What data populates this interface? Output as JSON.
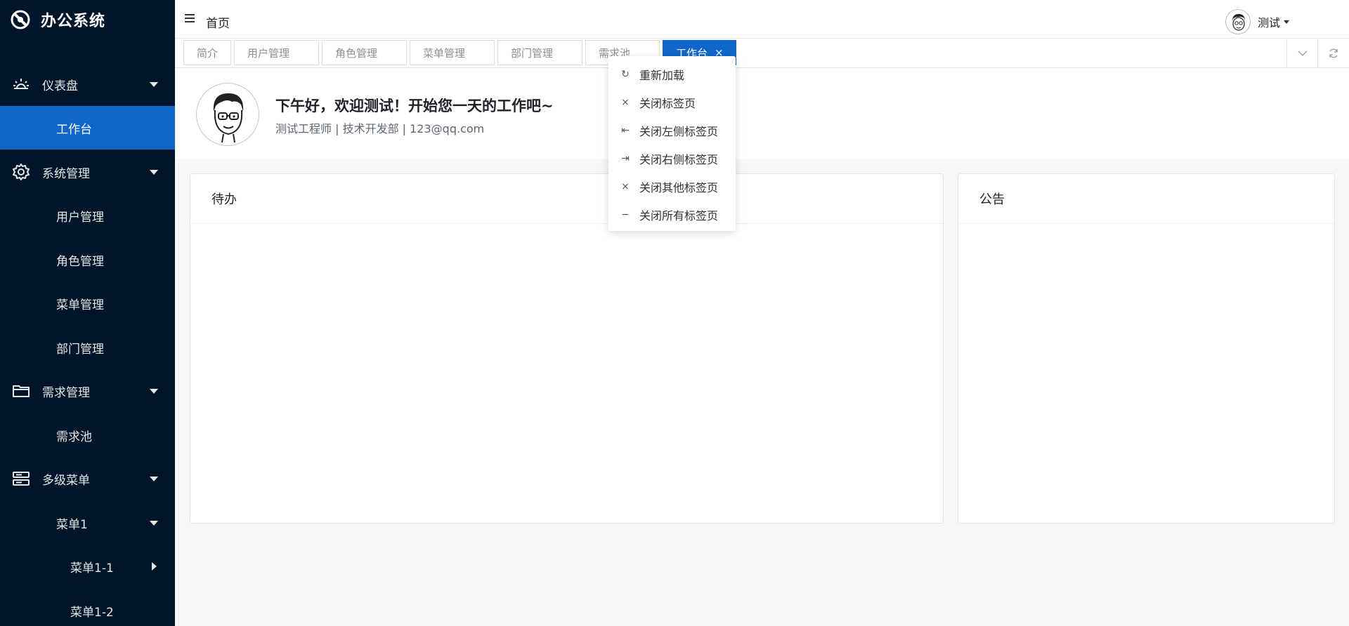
{
  "app": {
    "title": "办公系统"
  },
  "sidebar": {
    "items": [
      {
        "label": "仪表盘",
        "icon": "dashboard-icon",
        "level": 0,
        "caret": "down"
      },
      {
        "label": "工作台",
        "level": 1,
        "active": true
      },
      {
        "label": "系统管理",
        "icon": "gear-icon",
        "level": 0,
        "caret": "down"
      },
      {
        "label": "用户管理",
        "level": 1
      },
      {
        "label": "角色管理",
        "level": 1
      },
      {
        "label": "菜单管理",
        "level": 1
      },
      {
        "label": "部门管理",
        "level": 1
      },
      {
        "label": "需求管理",
        "icon": "folder-icon",
        "level": 0,
        "caret": "down"
      },
      {
        "label": "需求池",
        "level": 1
      },
      {
        "label": "多级菜单",
        "icon": "server-icon",
        "level": 0,
        "caret": "down"
      },
      {
        "label": "菜单1",
        "level": 1,
        "caret": "down"
      },
      {
        "label": "菜单1-1",
        "level": 2,
        "caret": "right"
      },
      {
        "label": "菜单1-2",
        "level": 2
      }
    ]
  },
  "header": {
    "breadcrumb": "首页",
    "user_name": "测试"
  },
  "tabs": [
    {
      "label": "简介"
    },
    {
      "label": "用户管理"
    },
    {
      "label": "角色管理"
    },
    {
      "label": "菜单管理"
    },
    {
      "label": "部门管理"
    },
    {
      "label": "需求池"
    },
    {
      "label": "工作台",
      "active": true,
      "close": "×"
    }
  ],
  "welcome": {
    "greeting": "下午好，欢迎测试！开始您一天的工作吧~",
    "subtitle": "测试工程师 | 技术开发部 | 123@qq.com"
  },
  "cards": {
    "todo_title": "待办",
    "notice_title": "公告"
  },
  "context_menu": {
    "items": [
      {
        "label": "重新加载",
        "icon": "reload-icon",
        "glyph": "↻"
      },
      {
        "label": "关闭标签页",
        "icon": "close-icon",
        "glyph": "×"
      },
      {
        "label": "关闭左侧标签页",
        "icon": "close-left-icon",
        "glyph": "⇤"
      },
      {
        "label": "关闭右侧标签页",
        "icon": "close-right-icon",
        "glyph": "⇥"
      },
      {
        "label": "关闭其他标签页",
        "icon": "close-other-icon",
        "glyph": "×"
      },
      {
        "label": "关闭所有标签页",
        "icon": "close-all-icon",
        "glyph": "−"
      }
    ]
  },
  "colors": {
    "sidebar_bg": "#001529",
    "accent": "#1067c9",
    "page_bg": "#f5f6f8"
  }
}
